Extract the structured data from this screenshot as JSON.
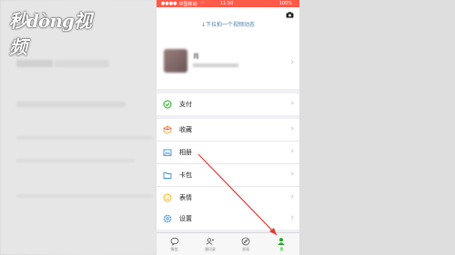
{
  "watermark": {
    "text": "秒dòng视频"
  },
  "status_bar": {
    "carrier": "中国移动",
    "time": "11:50",
    "battery": "100%"
  },
  "header": {
    "hint": "↓下拉拍一个视频动态",
    "nickname": "肖"
  },
  "menu": {
    "group1": [
      {
        "label": "支付",
        "icon": "pay-icon"
      }
    ],
    "group2": [
      {
        "label": "收藏",
        "icon": "favorites-icon"
      },
      {
        "label": "相册",
        "icon": "album-icon"
      },
      {
        "label": "卡包",
        "icon": "card-icon"
      },
      {
        "label": "表情",
        "icon": "sticker-icon"
      }
    ],
    "group3": [
      {
        "label": "设置",
        "icon": "settings-icon"
      }
    ]
  },
  "tabbar": [
    {
      "label": "微信",
      "icon": "chat-icon"
    },
    {
      "label": "通讯录",
      "icon": "contacts-icon"
    },
    {
      "label": "发现",
      "icon": "discover-icon"
    },
    {
      "label": "我",
      "icon": "me-icon"
    }
  ],
  "colors": {
    "status": "#ff5a4a",
    "accent": "#1aad19",
    "link": "#4c7ba8",
    "annotation": "#e53935"
  }
}
